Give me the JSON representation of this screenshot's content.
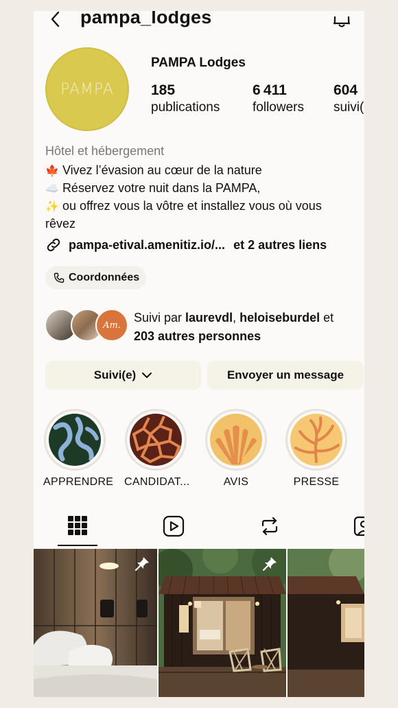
{
  "header": {
    "username": "pampa_lodges",
    "back_icon": "chevron-left-icon",
    "bell_icon": "bell-icon"
  },
  "profile": {
    "avatar_text": "PAMPA",
    "display_name": "PAMPA Lodges",
    "stats": [
      {
        "number": "185",
        "label": "publications"
      },
      {
        "number": "6 411",
        "label": "followers"
      },
      {
        "number": "604",
        "label": "suivi(e)s"
      }
    ],
    "category": "Hôtel et hébergement",
    "bio": [
      {
        "emoji": "🍁",
        "text": "Vivez l’évasion au cœur de la nature"
      },
      {
        "emoji": "☁️",
        "text": "Réservez votre nuit dans la PAMPA,"
      },
      {
        "emoji": "✨",
        "text": "ou offrez vous la vôtre et installez vous où vous"
      },
      {
        "emoji": "",
        "text": "rêvez"
      }
    ],
    "link": {
      "url": "pampa-etival.amenitiz.io/...",
      "more": "et 2 autres liens"
    },
    "contact_button": "Coordonnées",
    "followed_by": {
      "prefix": "Suivi par ",
      "user1": "laurevdl",
      "sep": ", ",
      "user2": "heloiseburdel",
      "suffix": " et",
      "others": "203 autres personnes"
    },
    "fav3_text": "Am."
  },
  "actions": {
    "follow_label": "Suivi(e)",
    "message_label": "Envoyer un message"
  },
  "highlights": [
    {
      "label": "APPRENDRE"
    },
    {
      "label": "CANDIDAT..."
    },
    {
      "label": "AVIS"
    },
    {
      "label": "PRESSE"
    }
  ],
  "tabs": [
    "grid-icon",
    "reels-icon",
    "reposts-icon",
    "tagged-icon"
  ],
  "colors": {
    "avatar": "#d9c94f",
    "button_bg": "#f5f2e8",
    "page_bg": "#fbfaf8"
  }
}
